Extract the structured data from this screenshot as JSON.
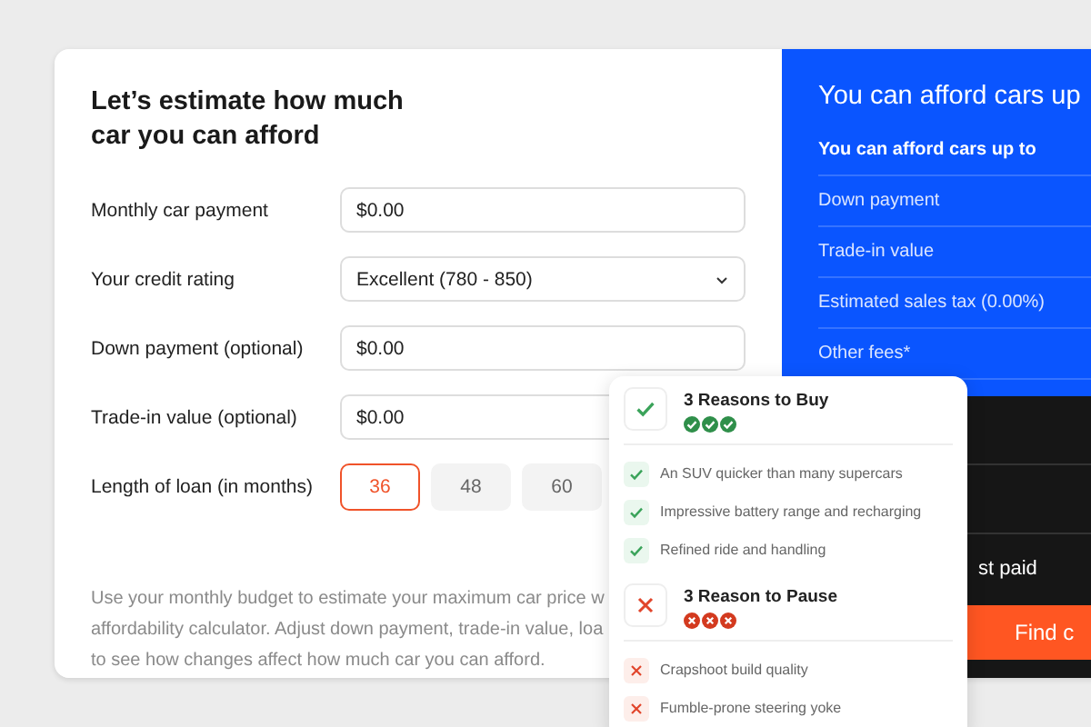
{
  "calculator": {
    "title": "Let’s estimate how much car you can afford",
    "fields": [
      {
        "kind": "input",
        "label": "Monthly car payment",
        "value": "$0.00"
      },
      {
        "kind": "select",
        "label": "Your credit rating",
        "value": "Excellent (780 - 850)"
      },
      {
        "kind": "input",
        "label": "Down payment (optional)",
        "value": "$0.00"
      },
      {
        "kind": "input",
        "label": "Trade-in value (optional)",
        "value": "$0.00"
      }
    ],
    "loan": {
      "label": "Length of loan (in months)",
      "options": [
        {
          "label": "36",
          "selected": true
        },
        {
          "label": "48",
          "selected": false
        },
        {
          "label": "60",
          "selected": false
        }
      ]
    },
    "description": "Use your monthly budget to estimate your maximum car price w affordability calculator. Adjust down payment, trade-in value, loa to see how changes affect how much car you can afford."
  },
  "results": {
    "title": "You can afford cars up",
    "rows": [
      {
        "kind": "heading",
        "label": "You can afford cars up to"
      },
      {
        "kind": "item",
        "label": "Down payment"
      },
      {
        "kind": "item",
        "label": "Trade-in value"
      },
      {
        "kind": "item",
        "label": "Estimated sales tax (0.00%)"
      },
      {
        "kind": "item",
        "label": "Other fees*"
      }
    ],
    "total_label": "st paid",
    "button": "Find c"
  },
  "popup": {
    "sections": [
      {
        "kind": "pros",
        "title": "3 Reasons to Buy",
        "items": [
          "An SUV quicker than many supercars",
          "Impressive battery range and recharging",
          "Refined ride and handling"
        ]
      },
      {
        "kind": "cons",
        "title": "3 Reason to Pause",
        "items": [
          "Crapshoot build quality",
          "Fumble-prone steering yoke"
        ]
      }
    ]
  }
}
